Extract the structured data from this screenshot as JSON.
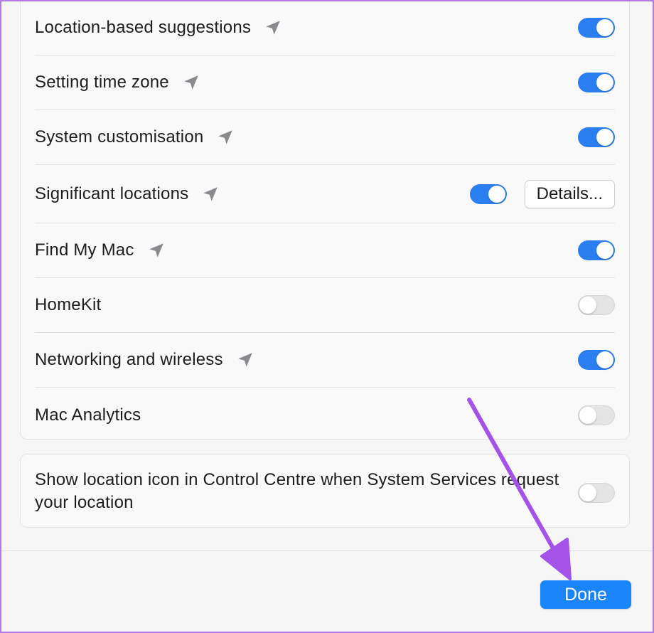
{
  "colors": {
    "accent": "#2a7ef0",
    "done_button": "#1a84fb",
    "annotation_arrow": "#a352ea",
    "frame_border": "#b179e6"
  },
  "location_icon": "location-arrow-icon",
  "services": [
    {
      "label": "Location-based suggestions",
      "location_icon": true,
      "enabled": true
    },
    {
      "label": "Setting time zone",
      "location_icon": true,
      "enabled": true
    },
    {
      "label": "System customisation",
      "location_icon": true,
      "enabled": true
    },
    {
      "label": "Significant locations",
      "location_icon": true,
      "enabled": true,
      "details_label": "Details..."
    },
    {
      "label": "Find My Mac",
      "location_icon": true,
      "enabled": true
    },
    {
      "label": "HomeKit",
      "location_icon": false,
      "enabled": false
    },
    {
      "label": "Networking and wireless",
      "location_icon": true,
      "enabled": true
    },
    {
      "label": "Mac Analytics",
      "location_icon": false,
      "enabled": false
    }
  ],
  "control_centre": {
    "label": "Show location icon in Control Centre when System Services request your location",
    "enabled": false
  },
  "footer": {
    "done_label": "Done"
  }
}
